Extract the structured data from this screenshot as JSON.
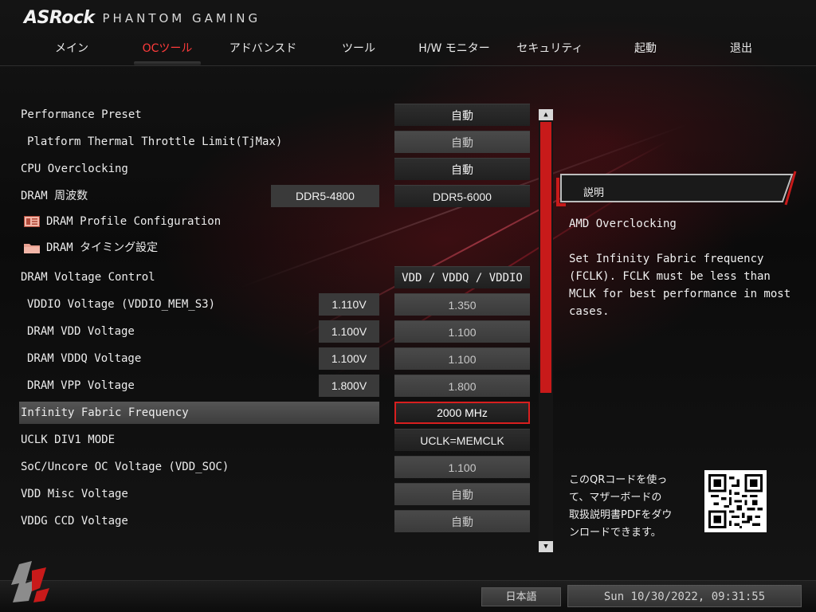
{
  "header": {
    "brand": "ASRock",
    "subtitle": "PHANTOM GAMING"
  },
  "tabs": [
    {
      "label": "メイン",
      "active": false
    },
    {
      "label": "OCツール",
      "active": true
    },
    {
      "label": "アドバンスド",
      "active": false
    },
    {
      "label": "ツール",
      "active": false
    },
    {
      "label": "H/W モニター",
      "active": false
    },
    {
      "label": "セキュリティ",
      "active": false
    },
    {
      "label": "起動",
      "active": false
    },
    {
      "label": "退出",
      "active": false
    }
  ],
  "settings": {
    "performance_preset": {
      "label": "Performance Preset",
      "value": "自動"
    },
    "tjmax": {
      "label": "Platform Thermal Throttle Limit(TjMax)",
      "value": "自動"
    },
    "cpu_oc": {
      "label": "CPU Overclocking",
      "value": "自動"
    },
    "dram_freq": {
      "label": "DRAM 周波数",
      "current": "DDR5-4800",
      "value": "DDR5-6000"
    },
    "dram_profile": {
      "label": "DRAM Profile Configuration"
    },
    "dram_timing": {
      "label": "DRAM タイミング設定"
    },
    "dram_voltage_ctrl": {
      "label": "DRAM Voltage Control",
      "value": "VDD / VDDQ / VDDIO"
    },
    "vddio": {
      "label": "VDDIO Voltage (VDDIO_MEM_S3)",
      "current": "1.110V",
      "value": "1.350"
    },
    "dram_vdd": {
      "label": "DRAM VDD Voltage",
      "current": "1.100V",
      "value": "1.100"
    },
    "dram_vddq": {
      "label": "DRAM VDDQ Voltage",
      "current": "1.100V",
      "value": "1.100"
    },
    "dram_vpp": {
      "label": "DRAM VPP Voltage",
      "current": "1.800V",
      "value": "1.800"
    },
    "fclk": {
      "label": "Infinity Fabric Frequency",
      "value": "2000 MHz"
    },
    "uclk": {
      "label": "UCLK DIV1 MODE",
      "value": "UCLK=MEMCLK"
    },
    "soc_voltage": {
      "label": "SoC/Uncore OC Voltage (VDD_SOC)",
      "value": "1.100"
    },
    "vdd_misc": {
      "label": "VDD Misc Voltage",
      "value": "自動"
    },
    "vddg_ccd": {
      "label": "VDDG CCD Voltage",
      "value": "自動"
    }
  },
  "description": {
    "title": "説明",
    "heading": "AMD Overclocking",
    "lines": [
      "Set Infinity Fabric frequency",
      "(FCLK). FCLK must be less than",
      "MCLK for best performance in most",
      "cases."
    ],
    "qr_lines": [
      "このQRコードを使っ",
      "て、マザーボードの",
      "取扱説明書PDFをダウ",
      "ンロードできます。"
    ]
  },
  "footer": {
    "language": "日本語",
    "datetime": "Sun 10/30/2022, 09:31:55"
  },
  "colors": {
    "accent": "#d81f1f",
    "active_tab": "#ff3b3b"
  },
  "icons": {
    "profile": "profile-card-icon",
    "timing": "folder-icon",
    "scroll_up": "arrow-up-icon",
    "scroll_down": "arrow-down-icon",
    "qr": "qr-code-icon",
    "logo": "phantom-gaming-logo-icon"
  }
}
